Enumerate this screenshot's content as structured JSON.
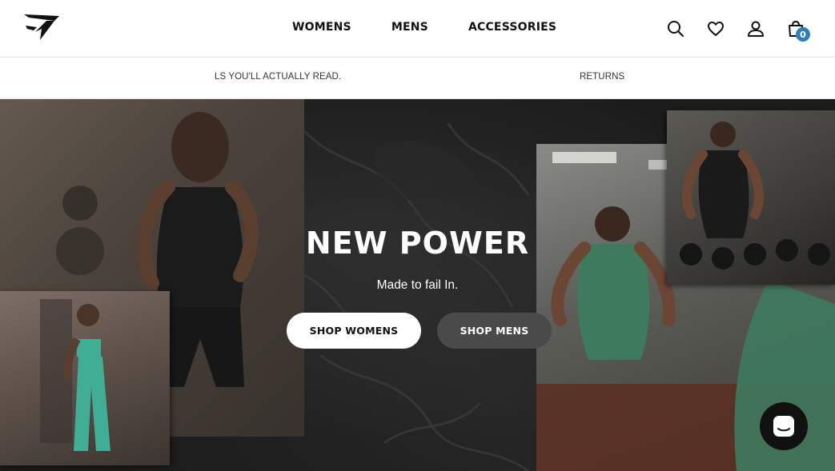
{
  "header": {
    "logo": "gymshark-logo",
    "nav": [
      {
        "label": "WOMENS"
      },
      {
        "label": "MENS"
      },
      {
        "label": "ACCESSORIES"
      }
    ],
    "icons": [
      "search-icon",
      "heart-icon",
      "account-icon",
      "bag-icon"
    ],
    "bag_count": "0",
    "badge_color": "#2d7fb8"
  },
  "promo": {
    "left_text": "LS YOU'LL ACTUALLY READ.",
    "right_text": "RETURNS"
  },
  "hero": {
    "title": "NEW POWER",
    "subtitle": "Made to fail In.",
    "primary_button": "SHOP WOMENS",
    "secondary_button": "SHOP MENS"
  },
  "chat": {
    "icon": "chat-icon"
  }
}
